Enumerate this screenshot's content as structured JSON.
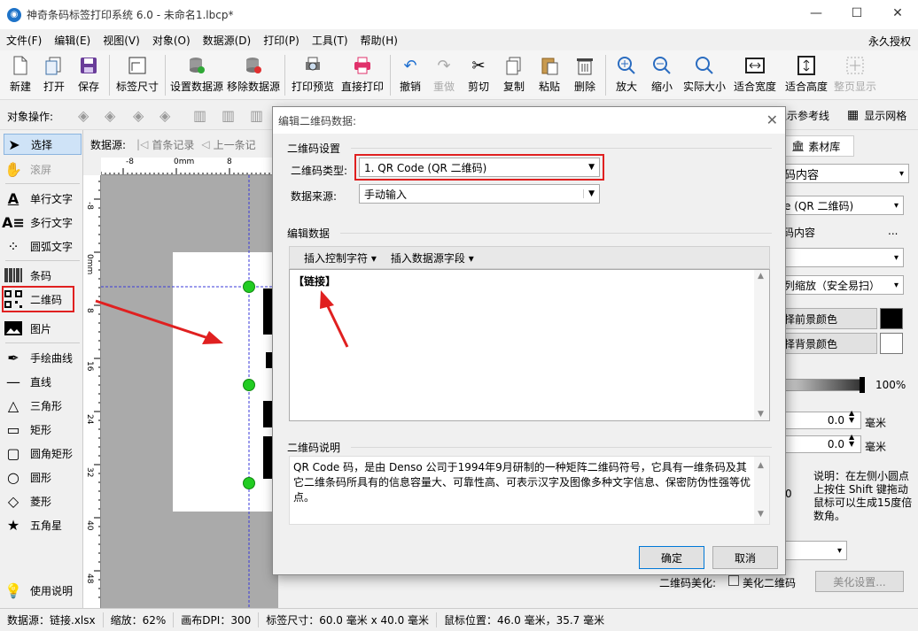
{
  "window": {
    "title": "神奇条码标签打印系统 6.0 - 未命名1.lbcp*",
    "minimize": "—",
    "maximize": "☐",
    "close": "✕"
  },
  "menu": {
    "items": [
      "文件(F)",
      "编辑(E)",
      "视图(V)",
      "对象(O)",
      "数据源(D)",
      "打印(P)",
      "工具(T)",
      "帮助(H)"
    ],
    "right": "永久授权"
  },
  "toolbar": {
    "buttons": [
      {
        "label": "新建",
        "icon": "new-file-icon"
      },
      {
        "label": "打开",
        "icon": "open-icon"
      },
      {
        "label": "保存",
        "icon": "save-icon"
      },
      {
        "label": "标签尺寸",
        "icon": "label-size-icon"
      },
      {
        "label": "设置数据源",
        "icon": "database-icon"
      },
      {
        "label": "移除数据源",
        "icon": "remove-database-icon"
      },
      {
        "label": "打印预览",
        "icon": "print-preview-icon"
      },
      {
        "label": "直接打印",
        "icon": "printer-icon"
      },
      {
        "label": "撤销",
        "icon": "undo-icon"
      },
      {
        "label": "重做",
        "icon": "redo-icon"
      },
      {
        "label": "剪切",
        "icon": "scissors-icon"
      },
      {
        "label": "复制",
        "icon": "copy-icon"
      },
      {
        "label": "粘贴",
        "icon": "paste-icon"
      },
      {
        "label": "删除",
        "icon": "trash-icon"
      },
      {
        "label": "放大",
        "icon": "zoom-in-icon"
      },
      {
        "label": "缩小",
        "icon": "zoom-out-icon"
      },
      {
        "label": "实际大小",
        "icon": "actual-size-icon"
      },
      {
        "label": "适合宽度",
        "icon": "fit-width-icon"
      },
      {
        "label": "适合高度",
        "icon": "fit-height-icon"
      },
      {
        "label": "整页显示",
        "icon": "fit-page-icon"
      }
    ]
  },
  "objrow": {
    "label": "对象操作:",
    "show_guides": "显示参考线",
    "show_grid": "显示网格"
  },
  "tools": {
    "select": "选择",
    "scroll": "滚屏",
    "single_text": "单行文字",
    "multi_text": "多行文字",
    "arc_text": "圆弧文字",
    "barcode": "条码",
    "qrcode": "二维码",
    "image": "图片",
    "freehand": "手绘曲线",
    "line": "直线",
    "triangle": "三角形",
    "rect": "矩形",
    "round_rect": "圆角矩形",
    "circle": "圆形",
    "diamond": "菱形",
    "star": "五角星",
    "help": "使用说明"
  },
  "nav": {
    "label": "数据源:",
    "first": "首条记录",
    "prev": "上一条记"
  },
  "ruler": {
    "h_ticks": [
      "-8",
      "0mm",
      "8"
    ],
    "v_ticks": [
      "-8",
      "0mm",
      "8",
      "16",
      "24",
      "32",
      "40",
      "48"
    ]
  },
  "right_panel": {
    "tab_material": "素材库",
    "content_select": "码内容",
    "type_select": "e (QR 二维码)",
    "content_label": "码内容",
    "content_more": "...",
    "scale_select": "列缩放（安全易扫）",
    "fg_color_btn": "择前景颜色",
    "bg_color_btn": "择背景颜色",
    "opacity": "100%",
    "x_value": "0.0",
    "y_value": "0.0",
    "unit1": "毫米",
    "unit2": "毫米",
    "zero": "0",
    "hint": "说明：在左侧小圆点上按住 Shift 键拖动鼠标可以生成15度倍数角。",
    "beautify_label": "二维码美化:",
    "beautify_check": "美化二维码",
    "beautify_btn": "美化设置...",
    "fg_color": "#000000",
    "bg_color": "#ffffff"
  },
  "dialog": {
    "title": "编辑二维码数据:",
    "close": "✕",
    "settings_group": "二维码设置",
    "type_label": "二维码类型:",
    "type_value": "1. QR Code (QR 二维码)",
    "source_label": "数据来源:",
    "source_value": "手动输入",
    "edit_group": "编辑数据",
    "insert_ctrl": "插入控制字符",
    "insert_field": "插入数据源字段",
    "edit_content": "【链接】",
    "desc_group": "二维码说明",
    "desc_text": "QR Code 码，是由 Denso 公司于1994年9月研制的一种矩阵二维码符号，它具有一维条码及其它二维条码所具有的信息容量大、可靠性高、可表示汉字及图像多种文字信息、保密防伪性强等优点。",
    "ok": "确定",
    "cancel": "取消"
  },
  "status": {
    "datasource": "数据源：链接.xlsx",
    "zoom": "缩放：62%",
    "dpi": "画布DPI：300",
    "label_size": "标签尺寸：60.0 毫米 x 40.0 毫米",
    "mouse_pos": "鼠标位置：46.0 毫米，35.7 毫米"
  },
  "colors": {
    "annotation_red": "#e02020",
    "handle_green": "#22cc22",
    "selection_blue": "#3a3ad8"
  }
}
